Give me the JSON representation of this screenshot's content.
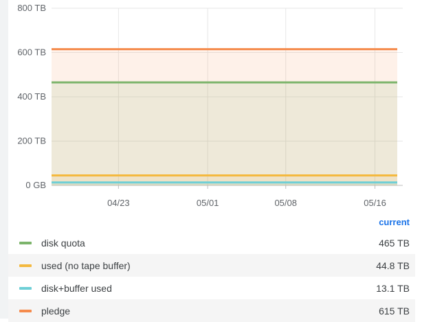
{
  "chart_data": {
    "type": "area",
    "x": [
      "04/17",
      "05/18"
    ],
    "xticks": [
      "04/23",
      "05/01",
      "05/08",
      "05/16"
    ],
    "yticks": [
      "800 TB",
      "600 TB",
      "400 TB",
      "200 TB",
      "0 GB"
    ],
    "ylim": [
      0,
      800
    ],
    "yunit": "TB",
    "grid": true,
    "series": [
      {
        "name": "disk quota",
        "values": [
          465,
          465
        ],
        "color": "#7cb46b"
      },
      {
        "name": "used (no tape buffer)",
        "values": [
          44.8,
          44.8
        ],
        "color": "#f4b93f"
      },
      {
        "name": "disk+buffer used",
        "values": [
          13.1,
          13.1
        ],
        "color": "#6ecfd6"
      },
      {
        "name": "pledge",
        "values": [
          615,
          615
        ],
        "color": "#f58b4c"
      }
    ]
  },
  "legend": {
    "header": "current",
    "items": [
      {
        "name": "disk quota",
        "value": "465 TB",
        "color": "#7cb46b"
      },
      {
        "name": "used (no tape buffer)",
        "value": "44.8 TB",
        "color": "#f4b93f"
      },
      {
        "name": "disk+buffer used",
        "value": "13.1 TB",
        "color": "#6ecfd6"
      },
      {
        "name": "pledge",
        "value": "615 TB",
        "color": "#f58b4c"
      }
    ]
  }
}
